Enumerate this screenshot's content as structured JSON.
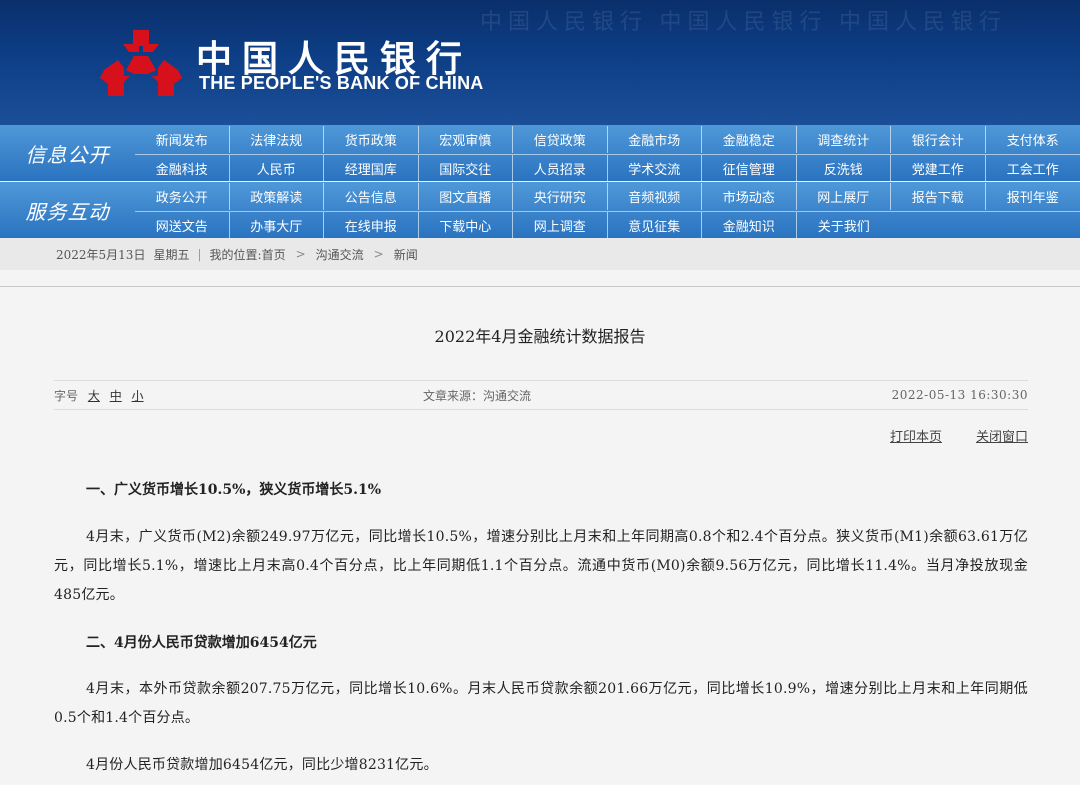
{
  "header": {
    "logo_cn": "中国人民银行",
    "logo_en": "THE PEOPLE'S BANK OF CHINA",
    "bg_pattern": "中国人民银行 中国人民银行 中国人民银行"
  },
  "nav": {
    "section1_label": "信息公开",
    "section2_label": "服务互动",
    "row1": [
      "新闻发布",
      "法律法规",
      "货币政策",
      "宏观审慎",
      "信贷政策",
      "金融市场",
      "金融稳定",
      "调查统计",
      "银行会计",
      "支付体系"
    ],
    "row2": [
      "金融科技",
      "人民币",
      "经理国库",
      "国际交往",
      "人员招录",
      "学术交流",
      "征信管理",
      "反洗钱",
      "党建工作",
      "工会工作"
    ],
    "row3": [
      "政务公开",
      "政策解读",
      "公告信息",
      "图文直播",
      "央行研究",
      "音频视频",
      "市场动态",
      "网上展厅",
      "报告下载",
      "报刊年鉴"
    ],
    "row4": [
      "网送文告",
      "办事大厅",
      "在线申报",
      "下载中心",
      "网上调查",
      "意见征集",
      "金融知识",
      "关于我们"
    ]
  },
  "breadcrumb": {
    "date": "2022年5月13日",
    "weekday": "星期五",
    "location_label": "我的位置:",
    "home": "首页",
    "sep": ">",
    "level1": "沟通交流",
    "level2": "新闻"
  },
  "article": {
    "title": "2022年4月金融统计数据报告",
    "font_label": "字号",
    "font_large": "大",
    "font_medium": "中",
    "font_small": "小",
    "source": "文章来源：沟通交流",
    "timestamp": "2022-05-13 16:30:30",
    "print": "打印本页",
    "close": "关闭窗口",
    "heading1": "一、广义货币增长10.5%，狭义货币增长5.1%",
    "para1": "4月末，广义货币(M2)余额249.97万亿元，同比增长10.5%，增速分别比上月末和上年同期高0.8个和2.4个百分点。狭义货币(M1)余额63.61万亿元，同比增长5.1%，增速比上月末高0.4个百分点，比上年同期低1.1个百分点。流通中货币(M0)余额9.56万亿元，同比增长11.4%。当月净投放现金485亿元。",
    "heading2": "二、4月份人民币贷款增加6454亿元",
    "para2": "4月末，本外币贷款余额207.75万亿元，同比增长10.6%。月末人民币贷款余额201.66万亿元，同比增长10.9%，增速分别比上月末和上年同期低0.5个和1.4个百分点。",
    "para3": "4月份人民币贷款增加6454亿元，同比少增8231亿元。"
  },
  "colors": {
    "banner": "#0d3e86",
    "nav": "#2a73c0",
    "logo_red": "#d7111b"
  }
}
